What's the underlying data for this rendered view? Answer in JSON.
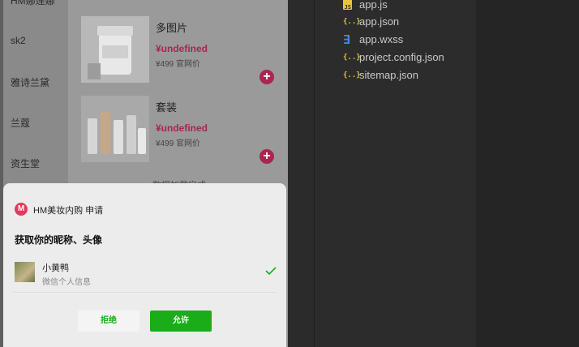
{
  "simulator": {
    "categories": [
      "HM娜莲娜",
      "sk2",
      "雅诗兰黛",
      "兰蔻",
      "资生堂"
    ],
    "products": [
      {
        "title": "多图片",
        "price": "¥undefined",
        "original": "¥499 官网价"
      },
      {
        "title": "套装",
        "price": "¥undefined",
        "original": "¥499 官网价"
      }
    ],
    "loading_text": "数据加载完成..."
  },
  "dialog": {
    "app_logo": "M",
    "app_name": "HM美妆内购  申请",
    "title": "获取你的昵称、头像",
    "user": {
      "name": "小黄鸭",
      "subtitle": "微信个人信息"
    },
    "reject_label": "拒绝",
    "allow_label": "允许"
  },
  "file_tree": [
    {
      "name": "app.js",
      "type": "js",
      "icon_text": "JS"
    },
    {
      "name": "app.json",
      "type": "json",
      "icon_text": "{..}"
    },
    {
      "name": "app.wxss",
      "type": "css",
      "icon_text": "∃"
    },
    {
      "name": "project.config.json",
      "type": "json",
      "icon_text": "{..}"
    },
    {
      "name": "sitemap.json",
      "type": "json",
      "icon_text": "{..}"
    }
  ],
  "colors": {
    "accent": "#1aad19",
    "price": "#a8254f",
    "js": "#e8c440",
    "wxss": "#3b8ee6"
  }
}
